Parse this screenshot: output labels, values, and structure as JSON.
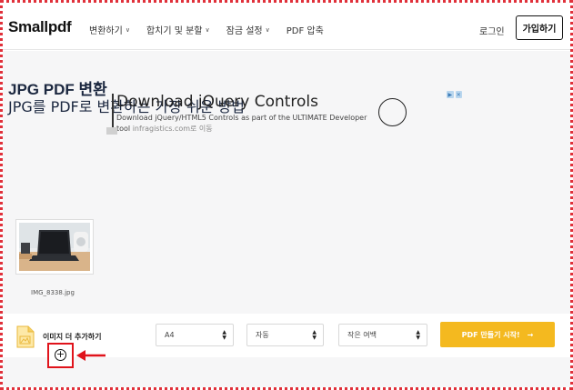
{
  "header": {
    "logo": "Smallpdf",
    "nav": [
      {
        "label": "변환하기"
      },
      {
        "label": "합치기 및 분할"
      },
      {
        "label": "잠금 설정"
      },
      {
        "label": "PDF 압축"
      }
    ],
    "login": "로그인",
    "signup": "가입하기"
  },
  "hero": {
    "title": "JPG PDF 변환",
    "subtitle": "JPG를 PDF로 변환하는 가장 쉬운 방법"
  },
  "ad": {
    "title": "Download jQuery Controls",
    "desc_line1": "Download jQuery/HTML5 Controls as part of the ULTIMATE Developer",
    "desc_line2_prefix": "tool",
    "desc_line2_domain": "infragistics.com로 이동"
  },
  "files": {
    "items": [
      {
        "name": "IMG_8338.jpg"
      }
    ]
  },
  "toolbar": {
    "add_more": "이미지 더 추가하기",
    "page_size": "A4",
    "orientation": "자동",
    "margin": "작은 여백",
    "submit": "PDF 만들기 시작!"
  },
  "colors": {
    "accent": "#f4b91f",
    "annotation": "#e0131b",
    "frame": "#e0313b"
  }
}
